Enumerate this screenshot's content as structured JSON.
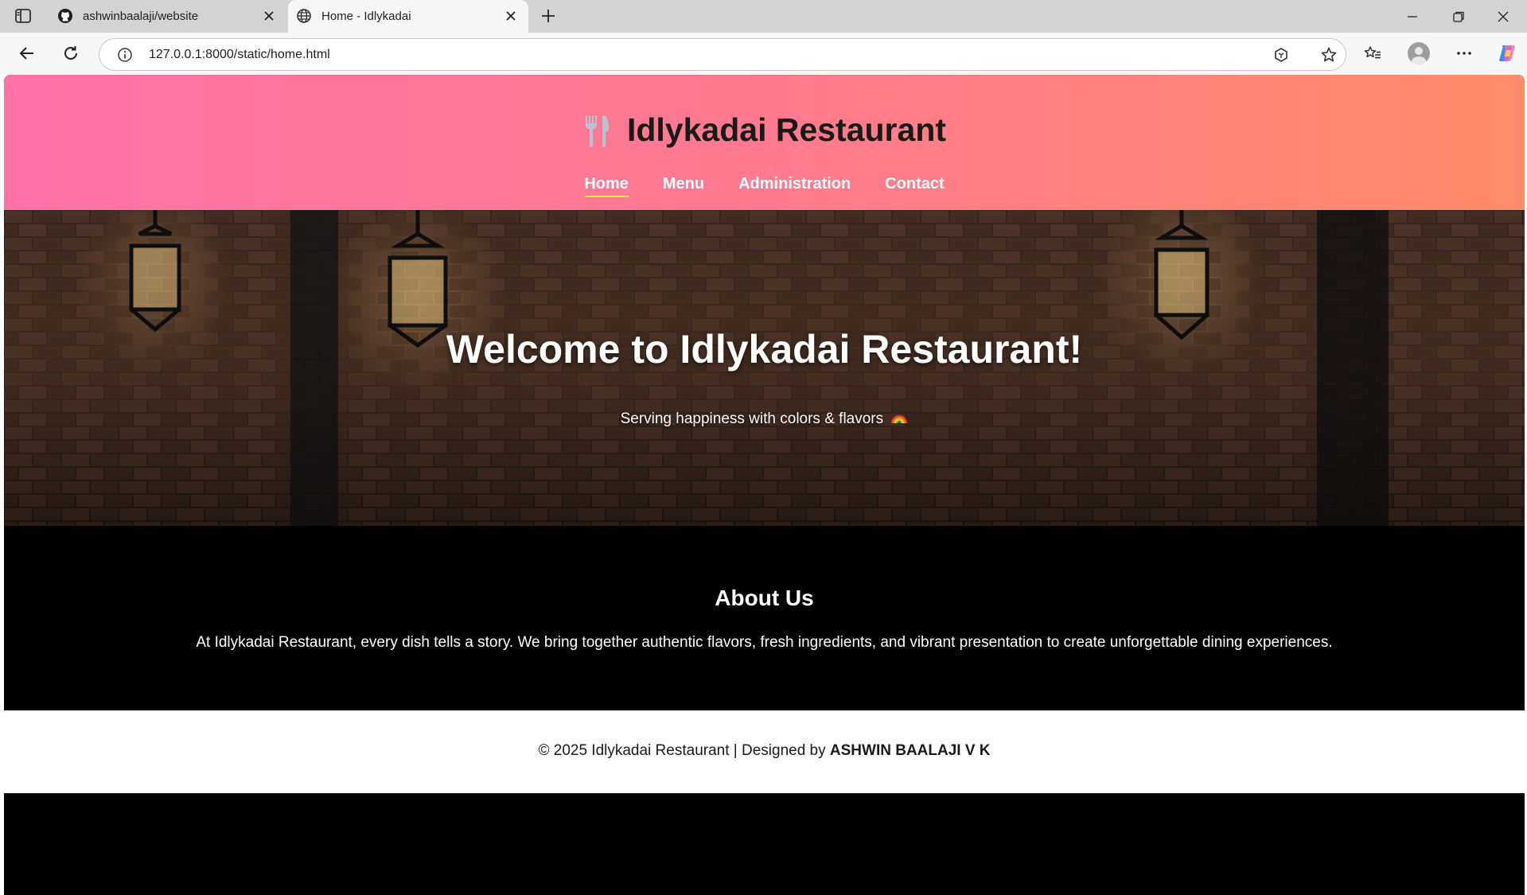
{
  "browser": {
    "tabs": [
      {
        "title": "ashwinbaalaji/website",
        "icon": "github-icon"
      },
      {
        "title": "Home - Idlykadai",
        "icon": "globe-icon",
        "active": true
      }
    ],
    "url": "127.0.0.1:8000/static/home.html"
  },
  "header": {
    "brand_icon": "fork-knife-icon",
    "brand_name": "Idlykadai Restaurant",
    "gradient": [
      "#fe72a8",
      "#ff8c69"
    ],
    "nav": [
      {
        "label": "Home",
        "active": true
      },
      {
        "label": "Menu"
      },
      {
        "label": "Administration"
      },
      {
        "label": "Contact"
      }
    ],
    "active_underline_color": "#ffe23a"
  },
  "hero": {
    "title": "Welcome to Idlykadai Restaurant!",
    "subtitle": "Serving happiness with colors & flavors",
    "subtitle_icon": "rainbow-icon"
  },
  "about": {
    "heading": "About Us",
    "text": "At Idlykadai Restaurant, every dish tells a story. We bring together authentic flavors, fresh ingredients, and vibrant presentation to create unforgettable dining experiences."
  },
  "footer": {
    "prefix": "© 2025 Idlykadai Restaurant | Designed by ",
    "designer": "ASHWIN BAALAJI V K"
  }
}
